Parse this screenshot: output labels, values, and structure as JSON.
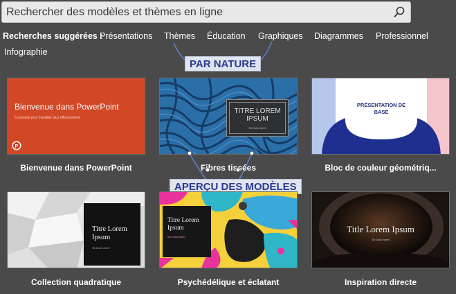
{
  "search": {
    "placeholder": "Rechercher des modèles et thèmes en ligne",
    "button_icon": "search-icon"
  },
  "suggestions": {
    "label": "Recherches suggérées :",
    "items": [
      "Présentations",
      "Thèmes",
      "Éducation",
      "Graphiques",
      "Diagrammes",
      "Professionnel",
      "Infographie"
    ]
  },
  "callouts": {
    "by_nature": "PAR NATURE",
    "template_preview": "APERÇU DES MODÈLES"
  },
  "templates": [
    {
      "name": "Bienvenue dans PowerPoint",
      "slide_title": "Bienvenue dans PowerPoint",
      "slide_subtitle": "5 conseils pour travailler plus efficacement",
      "logo_icon": "powerpoint-logo-icon",
      "color": "#d24726"
    },
    {
      "name": "Fibres tissées",
      "slide_title": "TITRE LOREM\nIPSUM",
      "slide_subtitle": "Sit Dolor Amet"
    },
    {
      "name": "Bloc de couleur géométriq...",
      "slide_title": "PRÉSENTATION DE\nBASE"
    },
    {
      "name": "Collection quadratique",
      "slide_title": "Titre Lorem\nIpsum",
      "slide_subtitle": "Sit Dolor Amet"
    },
    {
      "name": "Psychédélique et éclatant",
      "slide_title": "Titre Lorem\nIpsum",
      "slide_subtitle": "Sit Dolor Amet"
    },
    {
      "name": "Inspiration directe",
      "slide_title": "Title Lorem Ipsum",
      "slide_subtitle": "Sit Dolor Amet"
    }
  ],
  "colors": {
    "background": "#4a4a4a",
    "callout_bg": "#dfe4ee",
    "callout_text": "#2b3a8f",
    "connector": "#5b7fc7",
    "powerpoint_orange": "#d24726",
    "geometric_navy": "#1f2f8f"
  }
}
